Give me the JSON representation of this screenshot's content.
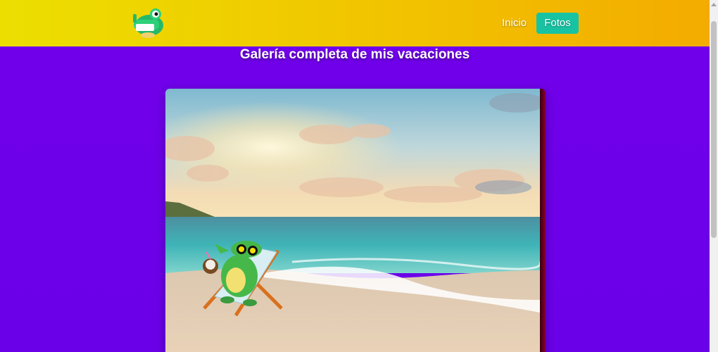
{
  "nav": {
    "logo_icon": "crocodile-logo-icon",
    "links": [
      {
        "label": "Inicio",
        "active": false
      },
      {
        "label": "Fotos",
        "active": true
      }
    ],
    "active_color": "#17c3a3"
  },
  "gallery": {
    "title": "Galería completa de mis vacaciones",
    "image_icon": "beach-crocodile-sunset-image"
  },
  "colors": {
    "background": "#6c00e6",
    "navbar_start": "#ecdf00",
    "navbar_end": "#f3ab00"
  }
}
